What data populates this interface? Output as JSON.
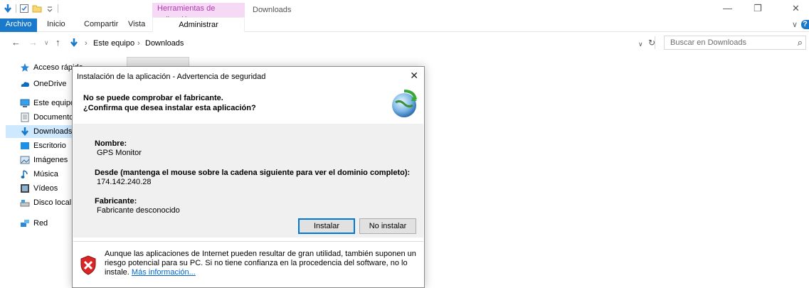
{
  "titlebar": {
    "context_tab_header": "Herramientas de aplicación",
    "window_title": "Downloads",
    "minimize_glyph": "—",
    "maximize_glyph": "❐",
    "close_glyph": "✕"
  },
  "ribbon": {
    "file_tab": "Archivo",
    "tabs": [
      "Inicio",
      "Compartir",
      "Vista"
    ],
    "context_tab": "Administrar",
    "collapse_glyph": "∨",
    "help_glyph": "?"
  },
  "address": {
    "back_glyph": "←",
    "forward_glyph": "→",
    "recent_glyph": "∨",
    "up_glyph": "↑",
    "crumbs": [
      "Este equipo",
      "Downloads"
    ],
    "crumb_sep": "›",
    "dropdown_glyph": "∨",
    "refresh_glyph": "↻",
    "search_placeholder": "Buscar en Downloads",
    "search_glyph": "⌕"
  },
  "nav_pane": {
    "items": [
      {
        "label": "Acceso rápido",
        "icon": "star-icon"
      },
      {
        "label": "OneDrive",
        "icon": "cloud-icon"
      },
      {
        "label": "Este equipo",
        "icon": "computer-icon"
      },
      {
        "label": "Documentos",
        "icon": "document-icon"
      },
      {
        "label": "Downloads",
        "icon": "download-icon"
      },
      {
        "label": "Escritorio",
        "icon": "desktop-icon"
      },
      {
        "label": "Imágenes",
        "icon": "pictures-icon"
      },
      {
        "label": "Música",
        "icon": "music-icon"
      },
      {
        "label": "Vídeos",
        "icon": "video-icon"
      },
      {
        "label": "Disco local",
        "icon": "drive-icon"
      },
      {
        "label": "Red",
        "icon": "network-icon"
      }
    ]
  },
  "dialog": {
    "title": "Instalación de la aplicación - Advertencia de seguridad",
    "close_glyph": "✕",
    "heading_line1": "No se puede comprobar el fabricante.",
    "heading_line2": "¿Confirma que desea instalar esta aplicación?",
    "name_label": "Nombre:",
    "name_value": "GPS Monitor",
    "from_label": "Desde (mantenga el mouse sobre la cadena siguiente para ver el dominio completo):",
    "from_value": "174.142.240.28",
    "publisher_label": "Fabricante:",
    "publisher_value": "Fabricante desconocido",
    "install_button": "Instalar",
    "dont_install_button": "No instalar",
    "warning_text": "Aunque las aplicaciones de Internet pueden resultar de gran utilidad, también suponen un riesgo potencial para su PC. Si no tiene confianza en la procedencia del software, no lo instale.",
    "more_info_link": "Más información..."
  },
  "colors": {
    "accent": "#1979ca",
    "context_tab": "#f5d9f5",
    "selected_nav": "#cde8ff",
    "link": "#0066cc"
  }
}
